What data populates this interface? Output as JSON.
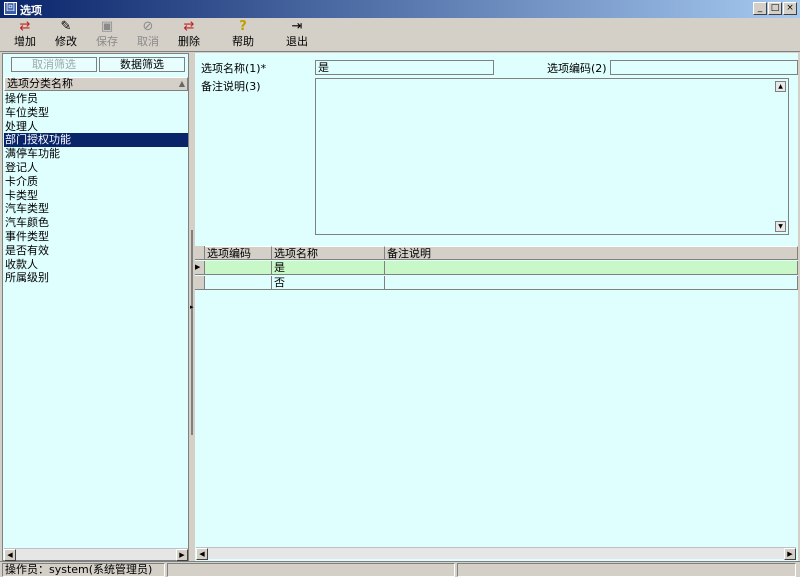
{
  "window": {
    "title": "选项",
    "icon_char": "回",
    "minimize": "_",
    "maximize": "□",
    "close": "×"
  },
  "toolbar": [
    {
      "id": "add",
      "icon": "add-icon",
      "glyph": "⇄",
      "label": "增加",
      "enabled": true
    },
    {
      "id": "edit",
      "icon": "edit-icon",
      "glyph": "✎",
      "label": "修改",
      "enabled": true
    },
    {
      "id": "save",
      "icon": "save-icon",
      "glyph": "▣",
      "label": "保存",
      "enabled": false
    },
    {
      "id": "cancel",
      "icon": "cancel-icon",
      "glyph": "⊘",
      "label": "取消",
      "enabled": false
    },
    {
      "id": "delete",
      "icon": "delete-icon",
      "glyph": "⇄",
      "label": "删除",
      "enabled": true
    },
    {
      "id": "help",
      "icon": "help-icon",
      "glyph": "?",
      "label": "帮助",
      "enabled": true
    },
    {
      "id": "exit",
      "icon": "exit-icon",
      "glyph": "⇥",
      "label": "退出",
      "enabled": true
    }
  ],
  "left_panel": {
    "cancel_filter": "取消筛选",
    "data_filter": "数据筛选",
    "column_header": "选项分类名称",
    "items": [
      "操作员",
      "车位类型",
      "处理人",
      "部门授权功能",
      "满停车功能",
      "登记人",
      "卡介质",
      "卡类型",
      "汽车类型",
      "汽车颜色",
      "事件类型",
      "是否有效",
      "收款人",
      "所属级别"
    ],
    "selected_index": 3
  },
  "form": {
    "name_label": "选项名称(1)*",
    "name_value": "是",
    "code_label": "选项编码(2)",
    "code_value": "",
    "remark_label": "备注说明(3)",
    "remark_value": ""
  },
  "grid": {
    "columns": [
      "选项编码",
      "选项名称",
      "备注说明"
    ],
    "rows": [
      {
        "code": "",
        "name": "是",
        "remark": ""
      },
      {
        "code": "",
        "name": "否",
        "remark": ""
      }
    ],
    "row_marker": "▶"
  },
  "status": {
    "operator": "操作员：system(系统管理员)"
  },
  "colors": {
    "panel_bg": "#dffefe",
    "selected_row": "#c8f8c8",
    "selection": "#0a246a"
  }
}
